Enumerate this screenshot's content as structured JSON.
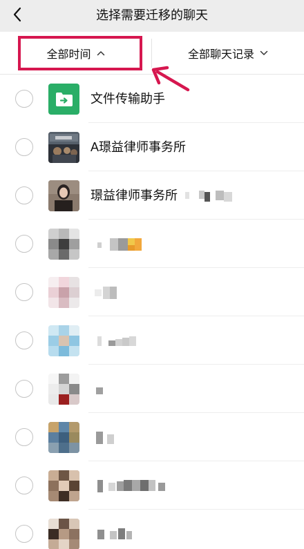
{
  "header": {
    "title": "选择需要迁移的聊天"
  },
  "filters": {
    "time_label": "全部时间",
    "type_label": "全部聊天记录"
  },
  "chats": [
    {
      "name": "文件传输助手",
      "avatar": "file-transfer-icon"
    },
    {
      "name": "A璟益律师事务所",
      "avatar": "photo"
    },
    {
      "name": "璟益律师事务所",
      "avatar": "photo"
    },
    {
      "name": "",
      "avatar": "pixelated"
    },
    {
      "name": "",
      "avatar": "pixelated"
    },
    {
      "name": "",
      "avatar": "pixelated"
    },
    {
      "name": "",
      "avatar": "pixelated"
    },
    {
      "name": "",
      "avatar": "pixelated"
    },
    {
      "name": "",
      "avatar": "pixelated"
    },
    {
      "name": "",
      "avatar": "pixelated"
    }
  ],
  "colors": {
    "nav_bg": "#ededed",
    "highlight": "#d6174f",
    "file_transfer_green": "#2aae67",
    "radio_border": "#c4c4c4"
  }
}
